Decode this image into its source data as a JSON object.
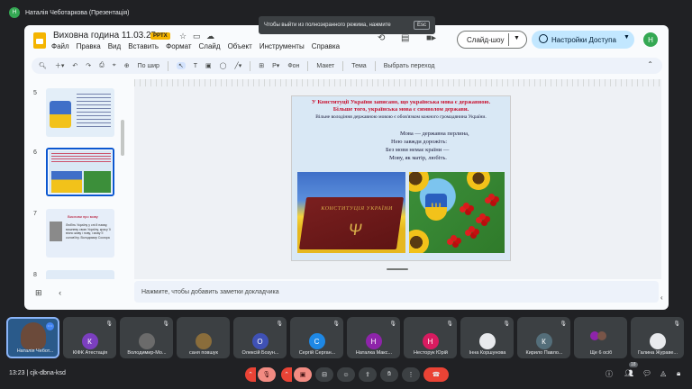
{
  "meet": {
    "presenter_initial": "Н",
    "presenter_label": "Наталія Чеботаркова (Презентація)",
    "fullscreen_toast": "Чтобы выйти из полноэкранного режима, нажмите",
    "esc_key": "Esc",
    "clock": "13:23",
    "meeting_code": "cjk-dbna-ksd",
    "participant_count": "18"
  },
  "slides_app": {
    "title": "Виховна година 11.03.25",
    "badge": "PPTX",
    "menu": [
      "Файл",
      "Правка",
      "Вид",
      "Вставить",
      "Формат",
      "Слайд",
      "Объект",
      "Инструменты",
      "Справка"
    ],
    "slideshow_label": "Слайд-шоу",
    "share_label": "Настройки Доступа",
    "user_initial": "Н",
    "toolbar": {
      "zoom_label": "По шир",
      "bg_label": "Фон",
      "layout_label": "Макет",
      "theme_label": "Тема",
      "transition_label": "Выбрать переход"
    },
    "filmstrip": [
      {
        "num": "5"
      },
      {
        "num": "6"
      },
      {
        "num": "7",
        "title": "Вислови про мову",
        "text": "Любіть Україну у сні й наяву, вишневу свою Україну, красу її вічно живу і нову, і мову її солов'їну. Володимир Сосюра"
      },
      {
        "num": "8"
      }
    ],
    "notes_placeholder": "Нажмите, чтобы добавить заметки докладчика"
  },
  "slide": {
    "line1": "У Конституції України  записано, що українська мова є державною.",
    "line2": "Більше того,  українська мова є символом держави.",
    "line3": "Вільне володіння державною мовою є обов'язком кожного громадянина України.",
    "poem": [
      "Мова — державна перлина,",
      "Нею завжди дорожіть:",
      "Без мови немає країни —",
      "Мову, як матір, любіть."
    ],
    "book_title": "КОНСТИТУЦІЯ УКРАЇНИ"
  },
  "participants": [
    {
      "name": "Наталія Чебот...",
      "initial": "",
      "color": "#5f6368"
    },
    {
      "name": "КІФК Атестація",
      "initial": "К",
      "color": "#7b3fbf"
    },
    {
      "name": "Володимир-Мо...",
      "initial": "",
      "color": "#6b6b6b"
    },
    {
      "name": "саня повшук",
      "initial": "",
      "color": "#8a6d3b"
    },
    {
      "name": "Олексій Бозун...",
      "initial": "О",
      "color": "#3f51b5"
    },
    {
      "name": "Сергій Серган...",
      "initial": "С",
      "color": "#1e88e5"
    },
    {
      "name": "Наталка Макс...",
      "initial": "Н",
      "color": "#8e24aa"
    },
    {
      "name": "Несторук Юрій",
      "initial": "Н",
      "color": "#d81b60"
    },
    {
      "name": "Інна Коршунова",
      "initial": "",
      "color": "#5f6368"
    },
    {
      "name": "Кирило Павло...",
      "initial": "К",
      "color": "#546e7a"
    },
    {
      "name": "Ще 6 осіб",
      "initial": "",
      "color": "#5f6368"
    },
    {
      "name": "Галина Жураве...",
      "initial": "",
      "color": "#5f6368"
    }
  ]
}
